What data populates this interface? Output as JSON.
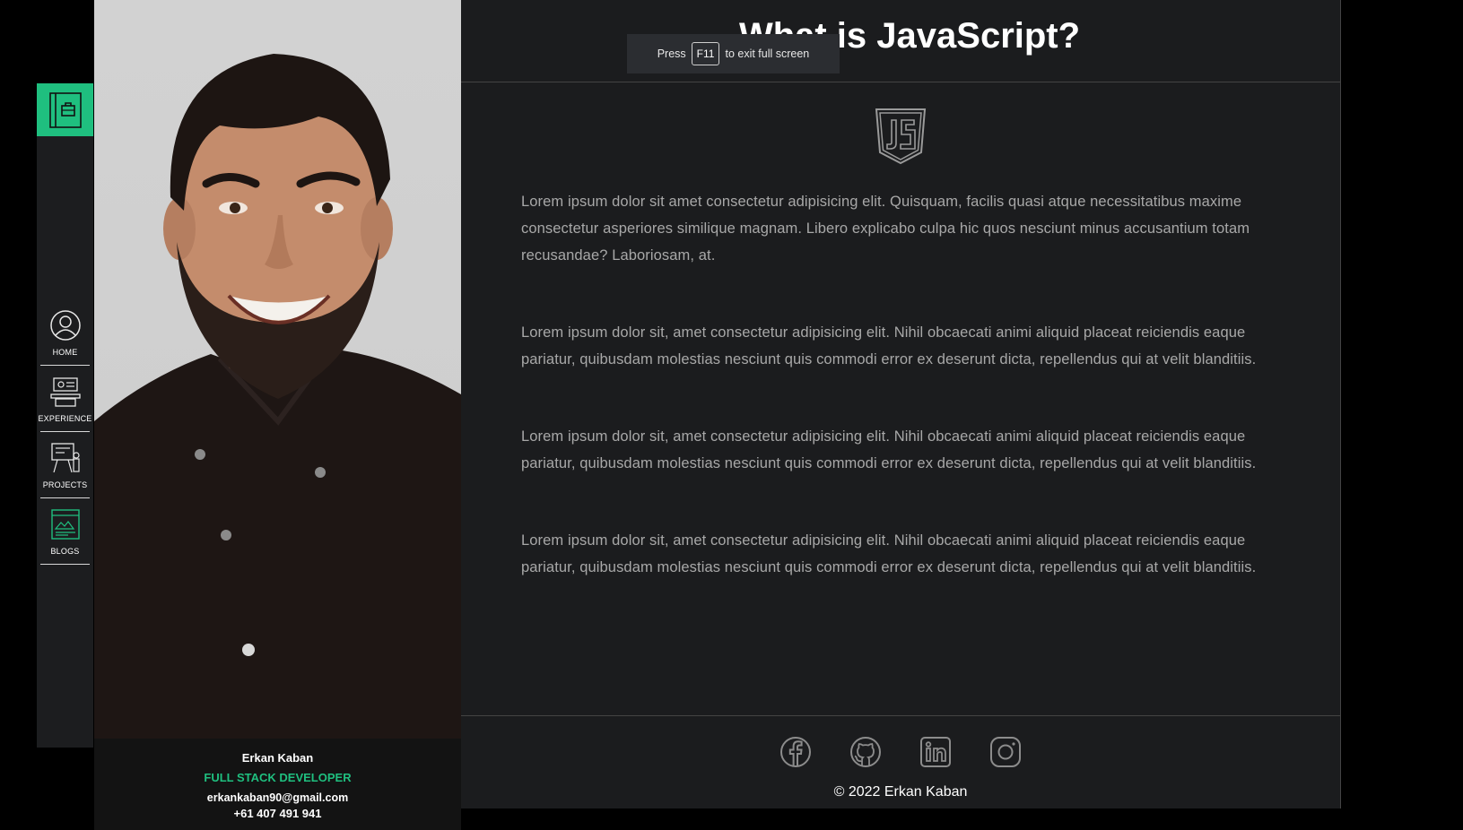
{
  "nav": {
    "items": [
      {
        "label": "HOME",
        "icon": "user-circle-icon"
      },
      {
        "label": "EXPERIENCE",
        "icon": "desk-icon"
      },
      {
        "label": "PROJECTS",
        "icon": "board-icon"
      },
      {
        "label": "BLOGS",
        "icon": "blog-icon"
      }
    ],
    "accent": "#1fbf7f"
  },
  "profile": {
    "name": "Erkan Kaban",
    "role": "FULL STACK DEVELOPER",
    "email": "erkankaban90@gmail.com",
    "phone": "+61 407 491 941"
  },
  "article": {
    "title": "What is JavaScript?",
    "logo_icon": "js-shield-icon",
    "paragraphs": [
      "Lorem ipsum dolor sit amet consectetur adipisicing elit. Quisquam, facilis quasi atque necessitatibus maxime consectetur asperiores similique magnam. Libero explicabo culpa hic quos nesciunt minus accusantium totam recusandae? Laboriosam, at.",
      "Lorem ipsum dolor sit, amet consectetur adipisicing elit. Nihil obcaecati animi aliquid placeat reiciendis eaque pariatur, quibusdam molestias nesciunt quis commodi error ex deserunt dicta, repellendus qui at velit blanditiis.",
      "Lorem ipsum dolor sit, amet consectetur adipisicing elit. Nihil obcaecati animi aliquid placeat reiciendis eaque pariatur, quibusdam molestias nesciunt quis commodi error ex deserunt dicta, repellendus qui at velit blanditiis.",
      "Lorem ipsum dolor sit, amet consectetur adipisicing elit. Nihil obcaecati animi aliquid placeat reiciendis eaque pariatur, quibusdam molestias nesciunt quis commodi error ex deserunt dicta, repellendus qui at velit blanditiis."
    ]
  },
  "footer": {
    "socials": [
      "facebook-icon",
      "github-icon",
      "linkedin-icon",
      "instagram-icon"
    ],
    "copyright": "© 2022 Erkan Kaban"
  },
  "toast": {
    "press": "Press",
    "key": "F11",
    "suffix": "to exit full screen"
  }
}
